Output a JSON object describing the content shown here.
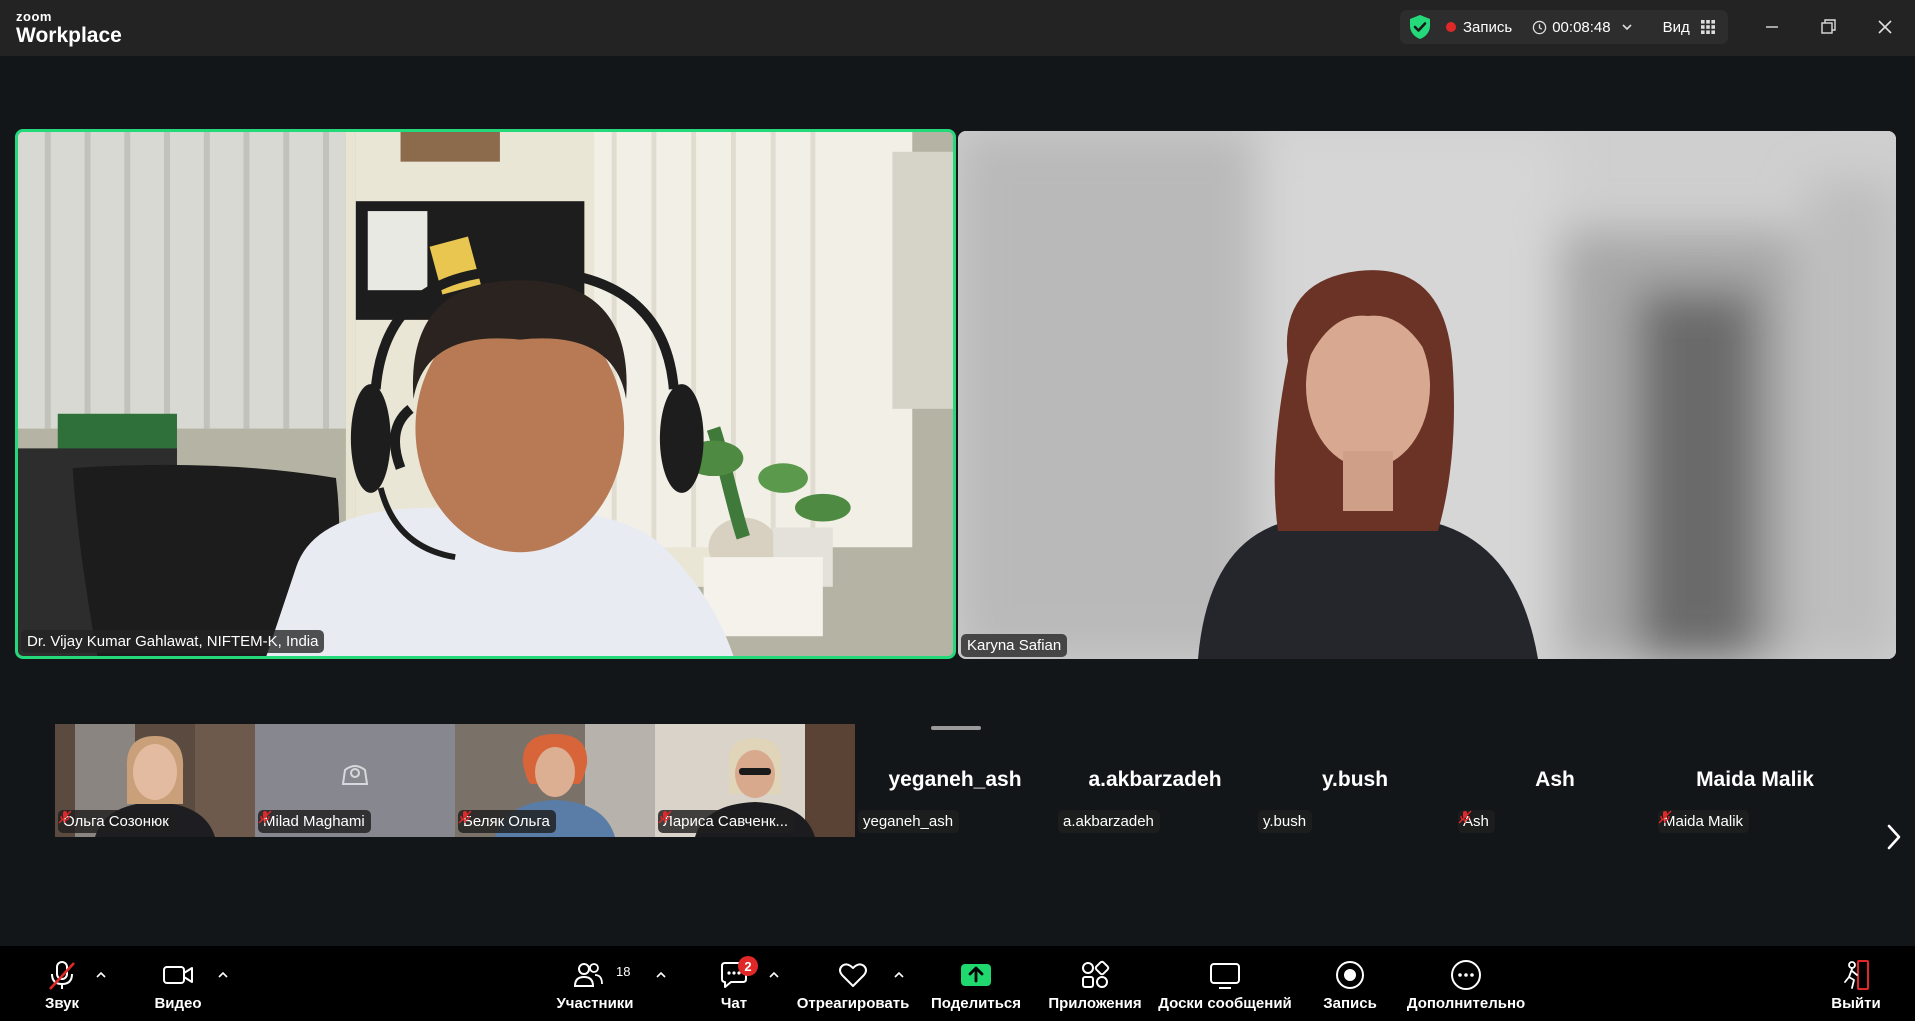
{
  "app": {
    "brand_top": "zoom",
    "brand_bottom": "Workplace"
  },
  "status": {
    "record_label": "Запись",
    "timer": "00:08:48",
    "view_label": "Вид"
  },
  "colors": {
    "speaker_border": "#23d97a",
    "record": "#e02828",
    "shield": "#23d97a",
    "share": "#1fd86e"
  },
  "main_tiles": [
    {
      "name": "Dr. Vijay Kumar Gahlawat, NIFTEM-K, India",
      "active_speaker": true
    },
    {
      "name": "Karyna Safian",
      "active_speaker": false
    }
  ],
  "strip": [
    {
      "name": "Ольга Созонюк",
      "muted": true,
      "video": true
    },
    {
      "name": "Milad Maghami",
      "muted": true,
      "video": false
    },
    {
      "name": "Беляк Ольга",
      "muted": true,
      "video": true
    },
    {
      "name": "Лариса Савченк...",
      "muted": true,
      "video": true
    },
    {
      "name": "yeganeh_ash",
      "muted": false,
      "video": false
    },
    {
      "name": "a.akbarzadeh",
      "muted": false,
      "video": false
    },
    {
      "name": "y.bush",
      "muted": false,
      "video": false
    },
    {
      "name": "Ash",
      "muted": true,
      "video": false
    },
    {
      "name": "Maida Malik",
      "muted": true,
      "video": false
    }
  ],
  "toolbar": {
    "audio": "Звук",
    "video": "Видео",
    "participants": "Участники",
    "participants_count": "18",
    "chat": "Чат",
    "chat_badge": "2",
    "react": "Отреагировать",
    "share": "Поделиться",
    "apps": "Приложения",
    "whiteboards": "Доски сообщений",
    "record": "Запись",
    "more": "Дополнительно",
    "leave": "Выйти"
  }
}
